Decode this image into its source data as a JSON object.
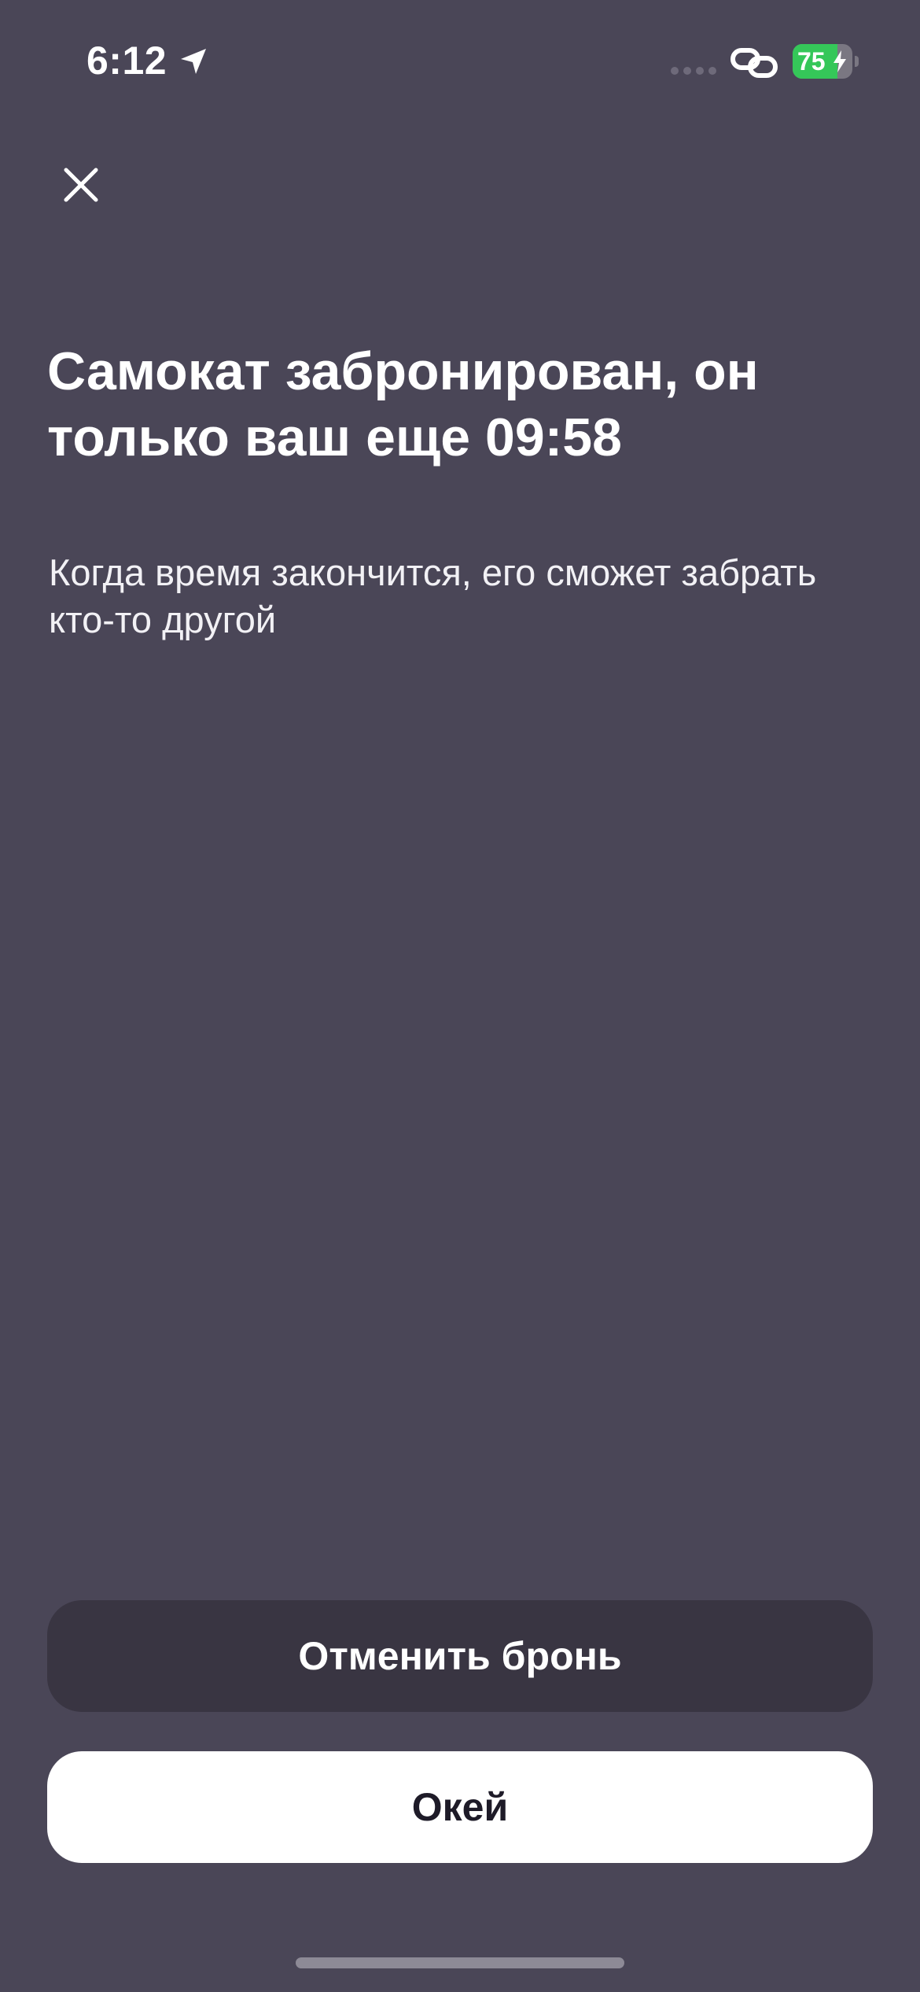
{
  "status_bar": {
    "time": "6:12",
    "battery_level": "75",
    "battery_fraction": 0.75,
    "location_icon": "location-arrow-icon",
    "signal_icon": "cellular-signal-icon",
    "link_icon": "link-icon",
    "bolt_icon": "charging-bolt-icon"
  },
  "header": {
    "close_icon": "close-icon"
  },
  "main": {
    "title": "Самокат забронирован, он только ваш еще 09:58",
    "subtitle": "Когда время закончится, его сможет забрать кто-то другой"
  },
  "actions": {
    "cancel_label": "Отменить бронь",
    "ok_label": "Окей"
  },
  "colors": {
    "background": "#4a4657",
    "cancel_button": "#393542",
    "ok_button": "#ffffff",
    "battery_green": "#35c759"
  }
}
